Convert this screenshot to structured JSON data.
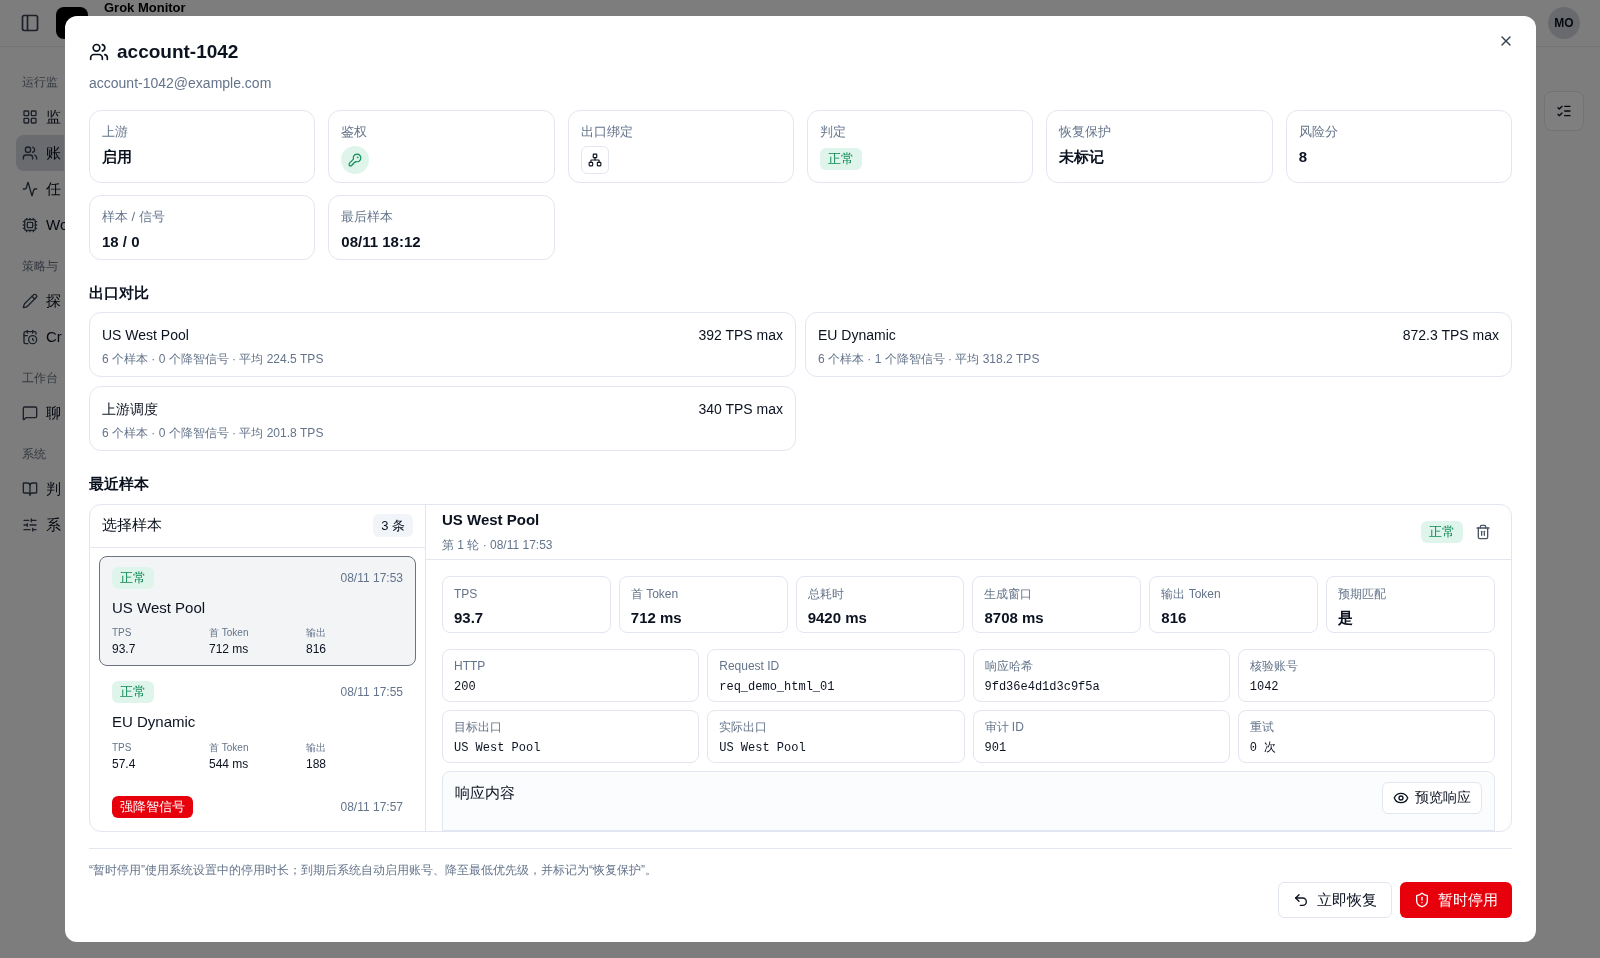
{
  "app": {
    "title": "Grok Monitor",
    "avatar": "MO"
  },
  "sidebar": {
    "groups": [
      {
        "label": "运行监",
        "items": [
          {
            "label": "监",
            "selected": false
          },
          {
            "label": "账",
            "selected": true
          },
          {
            "label": "任",
            "selected": false
          },
          {
            "label": "Wo",
            "selected": false
          }
        ]
      },
      {
        "label": "策略与",
        "items": [
          {
            "label": "探",
            "selected": false
          },
          {
            "label": "Cr",
            "selected": false
          }
        ]
      },
      {
        "label": "工作台",
        "items": [
          {
            "label": "聊",
            "selected": false
          }
        ]
      },
      {
        "label": "系统",
        "items": [
          {
            "label": "判",
            "selected": false
          },
          {
            "label": "系",
            "selected": false
          }
        ]
      }
    ]
  },
  "dialog": {
    "title": "account-1042",
    "subtitle": "account-1042@example.com",
    "info_cards": [
      {
        "label": "上游",
        "kind": "text",
        "value": "启用"
      },
      {
        "label": "鉴权",
        "kind": "key"
      },
      {
        "label": "出口绑定",
        "kind": "binding"
      },
      {
        "label": "判定",
        "kind": "badge",
        "badge": {
          "text": "正常",
          "kind": "ok"
        }
      },
      {
        "label": "恢复保护",
        "kind": "text",
        "value": "未标记"
      },
      {
        "label": "风险分",
        "kind": "text",
        "value": "8"
      },
      {
        "label": "样本 / 信号",
        "kind": "text",
        "value": "18 / 0"
      },
      {
        "label": "最后样本",
        "kind": "text",
        "value": "08/11 18:12"
      }
    ],
    "egress_title": "出口对比",
    "egress": [
      {
        "name": "US West Pool",
        "max": "392 TPS max",
        "summary": "6 个样本 · 0 个降智信号 · 平均 224.5 TPS"
      },
      {
        "name": "EU Dynamic",
        "max": "872.3 TPS max",
        "summary": "6 个样本 · 1 个降智信号 · 平均 318.2 TPS"
      },
      {
        "name": "上游调度",
        "max": "340 TPS max",
        "summary": "6 个样本 · 0 个降智信号 · 平均 201.8 TPS"
      }
    ],
    "samples_title": "最近样本",
    "sample_list": {
      "title": "选择样本",
      "count": "3 条",
      "items": [
        {
          "badge": "正常",
          "kind": "ok",
          "time": "08/11 17:53",
          "name": "US West Pool",
          "selected": true,
          "stats": [
            {
              "label": "TPS",
              "value": "93.7"
            },
            {
              "label": "首 Token",
              "value": "712 ms"
            },
            {
              "label": "输出",
              "value": "816"
            }
          ]
        },
        {
          "badge": "正常",
          "kind": "ok",
          "time": "08/11 17:55",
          "name": "EU Dynamic",
          "selected": false,
          "stats": [
            {
              "label": "TPS",
              "value": "57.4"
            },
            {
              "label": "首 Token",
              "value": "544 ms"
            },
            {
              "label": "输出",
              "value": "188"
            }
          ]
        },
        {
          "badge": "强降智信号",
          "kind": "alert",
          "time": "08/11 17:57",
          "selected": false
        }
      ]
    },
    "detail": {
      "title": "US West Pool",
      "meta": "第 1 轮 · 08/11 17:53",
      "badge": "正常",
      "kind": "ok",
      "metrics": [
        {
          "label": "TPS",
          "value": "93.7"
        },
        {
          "label": "首 Token",
          "value": "712 ms"
        },
        {
          "label": "总耗时",
          "value": "9420 ms"
        },
        {
          "label": "生成窗口",
          "value": "8708 ms"
        },
        {
          "label": "输出 Token",
          "value": "816"
        },
        {
          "label": "预期匹配",
          "value": "是"
        }
      ],
      "fields": [
        {
          "label": "HTTP",
          "value": "200"
        },
        {
          "label": "Request ID",
          "value": "req_demo_html_01"
        },
        {
          "label": "响应哈希",
          "value": "9fd36e4d1d3c9f5a"
        },
        {
          "label": "核验账号",
          "value": "1042"
        },
        {
          "label": "目标出口",
          "value": "US West Pool"
        },
        {
          "label": "实际出口",
          "value": "US West Pool"
        },
        {
          "label": "审计 ID",
          "value": "901"
        },
        {
          "label": "重试",
          "value": "0 次"
        }
      ],
      "response": {
        "title": "响应内容",
        "button": "预览响应"
      }
    },
    "note": "“暂时停用”使用系统设置中的停用时长；到期后系统自动启用账号、降至最低优先级，并标记为“恢复保护”。",
    "buttons": [
      {
        "label": "立即恢复",
        "kind": "secondary"
      },
      {
        "label": "暂时停用",
        "kind": "danger"
      }
    ]
  }
}
